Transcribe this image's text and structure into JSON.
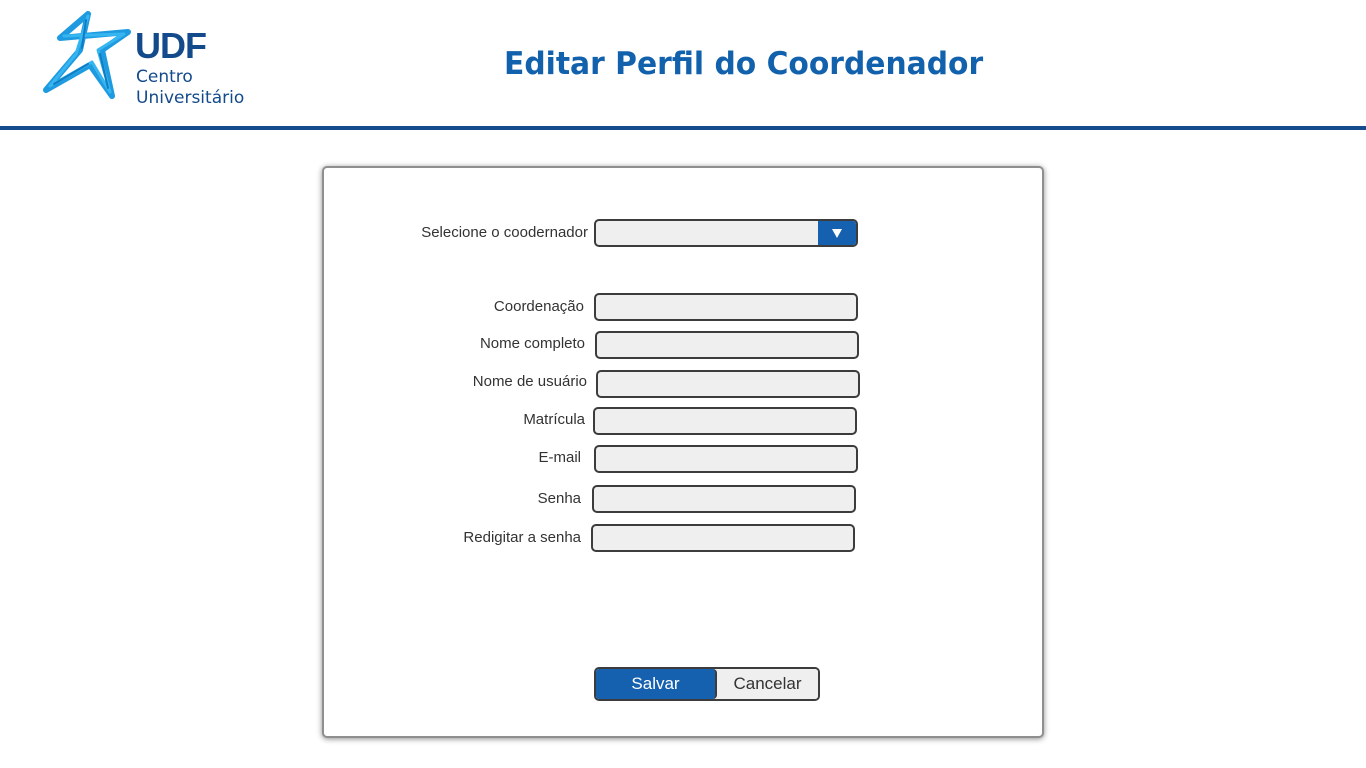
{
  "header": {
    "logo": {
      "brand": "UDF",
      "line1": "Centro",
      "line2": "Universitário",
      "icon": "star-logo-icon"
    },
    "title": "Editar Perfil do Coordenador"
  },
  "form": {
    "select_label": "Selecione o coodernador",
    "select_value": "",
    "fields": [
      {
        "label": "Coordenação",
        "value": ""
      },
      {
        "label": "Nome completo",
        "value": ""
      },
      {
        "label": "Nome de usuário",
        "value": ""
      },
      {
        "label": "Matrícula",
        "value": ""
      },
      {
        "label": "E-mail",
        "value": ""
      },
      {
        "label": "Senha",
        "value": ""
      },
      {
        "label": "Redigitar  a senha",
        "value": ""
      }
    ],
    "buttons": {
      "save": "Salvar",
      "cancel": "Cancelar"
    }
  },
  "colors": {
    "brand_blue": "#134a8c",
    "accent_blue": "#1561b0",
    "field_bg": "#efefef"
  }
}
